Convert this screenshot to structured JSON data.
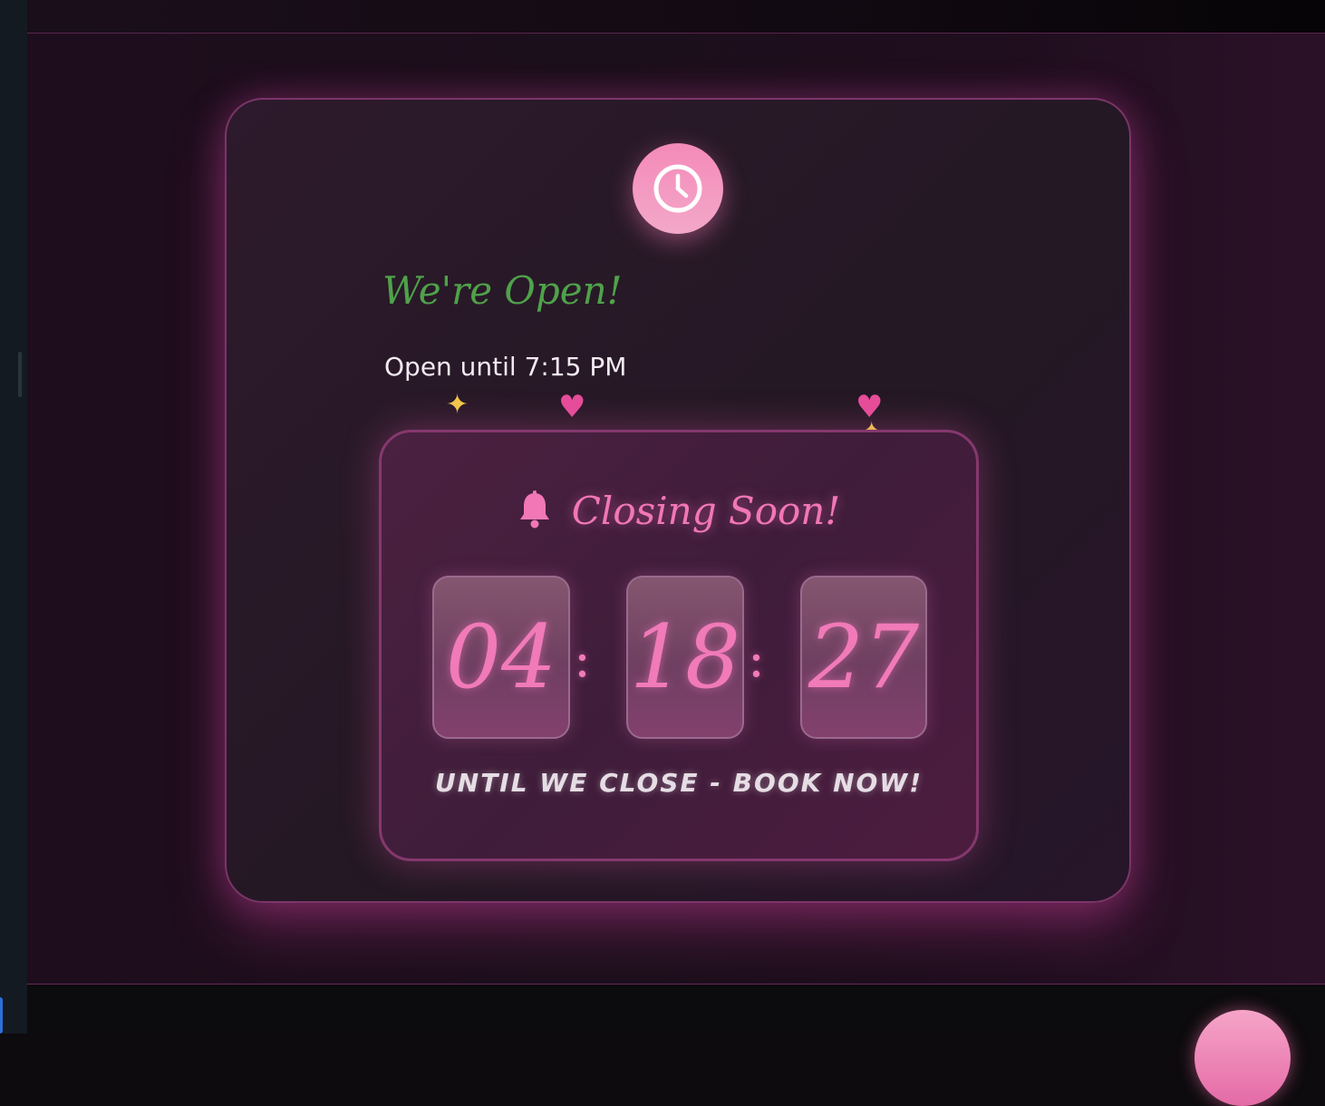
{
  "status_card": {
    "icon": "clock-icon",
    "headline": "We're Open!",
    "hours_text": "Open until 7:15 PM",
    "decorations": [
      "sparkles-icon",
      "heart-icon",
      "heart-icon",
      "sparkles-icon"
    ]
  },
  "countdown": {
    "icon": "bell-icon",
    "title": "Closing Soon!",
    "hours": "04",
    "minutes": "18",
    "seconds": "27",
    "separator": ":",
    "caption": "UNTIL WE CLOSE - BOOK NOW!"
  },
  "colors": {
    "accent_pink": "#f17ab9",
    "open_green": "#4fa24a",
    "border_pink": "#7b3569",
    "background": "#1e0d1d"
  }
}
